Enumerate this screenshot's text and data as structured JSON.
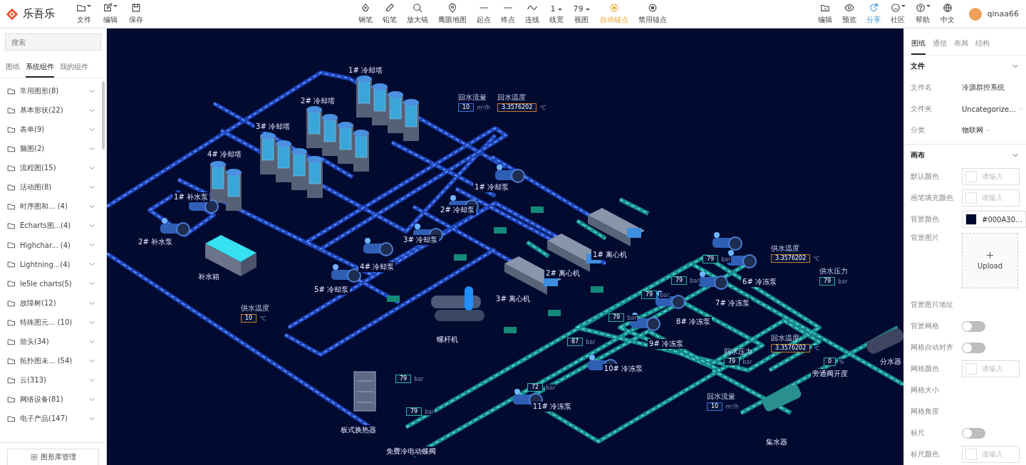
{
  "app": {
    "logo_text": "乐吾乐"
  },
  "toolbar": {
    "left": [
      {
        "label": "文件",
        "menu": true
      },
      {
        "label": "编辑",
        "menu": true
      },
      {
        "label": "保存",
        "menu": false
      }
    ],
    "center": [
      {
        "kind": "tool",
        "label": "钢笔"
      },
      {
        "kind": "tool",
        "label": "铅笔"
      },
      {
        "kind": "tool",
        "label": "放大镜"
      },
      {
        "kind": "tool",
        "label": "鹰眼地图"
      },
      {
        "kind": "tool",
        "label": "起点"
      },
      {
        "kind": "tool",
        "label": "终点"
      },
      {
        "kind": "tool",
        "label": "连线"
      },
      {
        "kind": "value",
        "value": "1",
        "label": "线宽"
      },
      {
        "kind": "value",
        "value": "79",
        "label": "视图"
      },
      {
        "kind": "toggle",
        "label": "自动锚点",
        "selected": true
      },
      {
        "kind": "toggle",
        "label": "禁用锚点",
        "selected": false
      }
    ],
    "right": [
      {
        "label": "编辑",
        "menu": false,
        "highlighted": false
      },
      {
        "label": "预览",
        "menu": false,
        "highlighted": false
      },
      {
        "label": "分享",
        "menu": false,
        "highlighted": true
      },
      {
        "label": "社区",
        "menu": true,
        "highlighted": false
      },
      {
        "label": "帮助",
        "menu": true,
        "highlighted": false
      },
      {
        "label": "中文",
        "menu": false,
        "highlighted": false
      }
    ],
    "user": "qinaa66"
  },
  "sidebar": {
    "search": {
      "placeholder": "搜索"
    },
    "tabs": [
      {
        "label": "图纸",
        "selected": false
      },
      {
        "label": "系统组件",
        "selected": true
      },
      {
        "label": "我的组件",
        "selected": false
      }
    ],
    "categories": [
      "常用图形(8)",
      "基本形状(22)",
      "表单(9)",
      "脑图(2)",
      "流程图(15)",
      "活动图(8)",
      "时序图和... (4)",
      "Echarts图...(4)",
      "Highchar... (4)",
      "Lightning...(4)",
      "le5le charts(5)",
      "故障树(12)",
      "特殊图元... (10)",
      "箭头(34)",
      "拓扑图未... (54)",
      "云(313)",
      "网络设备(81)",
      "电子产品(147)"
    ],
    "footer_button": "图形库管理"
  },
  "diagram": {
    "labels": [
      "1# 冷却塔",
      "2# 冷却塔",
      "3# 冷却塔",
      "4# 冷却塔",
      "1# 补水泵",
      "2# 补水泵",
      "补水箱",
      "1# 冷却泵",
      "2# 冷却泵",
      "3# 冷却泵",
      "4# 冷却泵",
      "5# 冷却泵",
      "1# 离心机",
      "2# 离心机",
      "3# 离心机",
      "螺杆机",
      "6# 冷冻泵",
      "7# 冷冻泵",
      "8# 冷冻泵",
      "9# 冷冻泵",
      "10# 冷冻泵",
      "11# 冷冻泵",
      "板式换热器",
      "免费冷电动蝶阀",
      "旁通阀开度",
      "分水器",
      "集水器"
    ],
    "readouts": [
      {
        "caption": "回水流量",
        "value": "10",
        "unit": "m³/h",
        "color": "#3b6fd8"
      },
      {
        "caption": "回水温度",
        "value": "3.3576202",
        "unit": "℃",
        "color": "#c07a2a"
      },
      {
        "caption": "供水温度",
        "value": "10",
        "unit": "℃",
        "color": "#c07a2a"
      },
      {
        "value": "79",
        "unit": "bar",
        "color": "#2bb0a0"
      },
      {
        "value": "79",
        "unit": "bar",
        "color": "#2bb0a0"
      },
      {
        "value": "79",
        "unit": "bar",
        "color": "#2bb0a0"
      },
      {
        "value": "79",
        "unit": "bar",
        "color": "#2bb0a0"
      },
      {
        "value": "87",
        "unit": "bar",
        "color": "#2bb0a0"
      },
      {
        "value": "72",
        "unit": "bar",
        "color": "#2bb0a0"
      },
      {
        "value": "79",
        "unit": "bar",
        "color": "#2bb0a0"
      },
      {
        "value": "79",
        "unit": "bar",
        "color": "#2bb0a0"
      },
      {
        "caption": "供水温度",
        "value": "3.3576202",
        "unit": "℃",
        "color": "#c07a2a"
      },
      {
        "caption": "供水压力",
        "value": "79",
        "unit": "bar",
        "color": "#2bb0a0"
      },
      {
        "caption": "回水温度",
        "value": "3.3576202",
        "unit": "℃",
        "color": "#c07a2a"
      },
      {
        "caption": "回水压力",
        "value": "79",
        "unit": "bar",
        "color": "#2bb0a0"
      },
      {
        "value": "0",
        "unit": "%",
        "color": "#2bb0a0"
      },
      {
        "caption": "回水流量",
        "value": "10",
        "unit": "m³/h",
        "color": "#3b6fd8"
      }
    ]
  },
  "properties": {
    "tabs": [
      {
        "label": "图纸",
        "selected": true
      },
      {
        "label": "通信",
        "selected": false
      },
      {
        "label": "布局",
        "selected": false
      },
      {
        "label": "结构",
        "selected": false
      }
    ],
    "sections": [
      {
        "title": "文件",
        "expanded": true,
        "rows": [
          {
            "kind": "text",
            "label": "文件名",
            "value": "冷源群控系统"
          },
          {
            "kind": "select",
            "label": "文件夹",
            "value": "Uncategorize..."
          },
          {
            "kind": "select",
            "label": "分类",
            "value": "物联网"
          }
        ]
      },
      {
        "title": "画布",
        "expanded": true,
        "rows": [
          {
            "kind": "color",
            "label": "默认颜色",
            "placeholder": "请输入"
          },
          {
            "kind": "color",
            "label": "画笔填充颜色",
            "placeholder": "请输入"
          },
          {
            "kind": "color",
            "label": "背景颜色",
            "value": "#000A30...",
            "color": "#000a30"
          },
          {
            "kind": "upload",
            "label": "背景图片",
            "button": "Upload"
          },
          {
            "kind": "label",
            "label": "背景图片地址"
          },
          {
            "kind": "toggle",
            "label": "背景网格",
            "on": false
          },
          {
            "kind": "toggle",
            "label": "网格自动对齐",
            "on": false
          },
          {
            "kind": "color",
            "label": "网格颜色",
            "placeholder": "请输入"
          },
          {
            "kind": "label",
            "label": "网格大小"
          },
          {
            "kind": "label",
            "label": "网格角度"
          },
          {
            "kind": "toggle",
            "label": "标尺",
            "on": false
          },
          {
            "kind": "color",
            "label": "标尺颜色",
            "placeholder": "请输入"
          }
        ]
      }
    ]
  }
}
